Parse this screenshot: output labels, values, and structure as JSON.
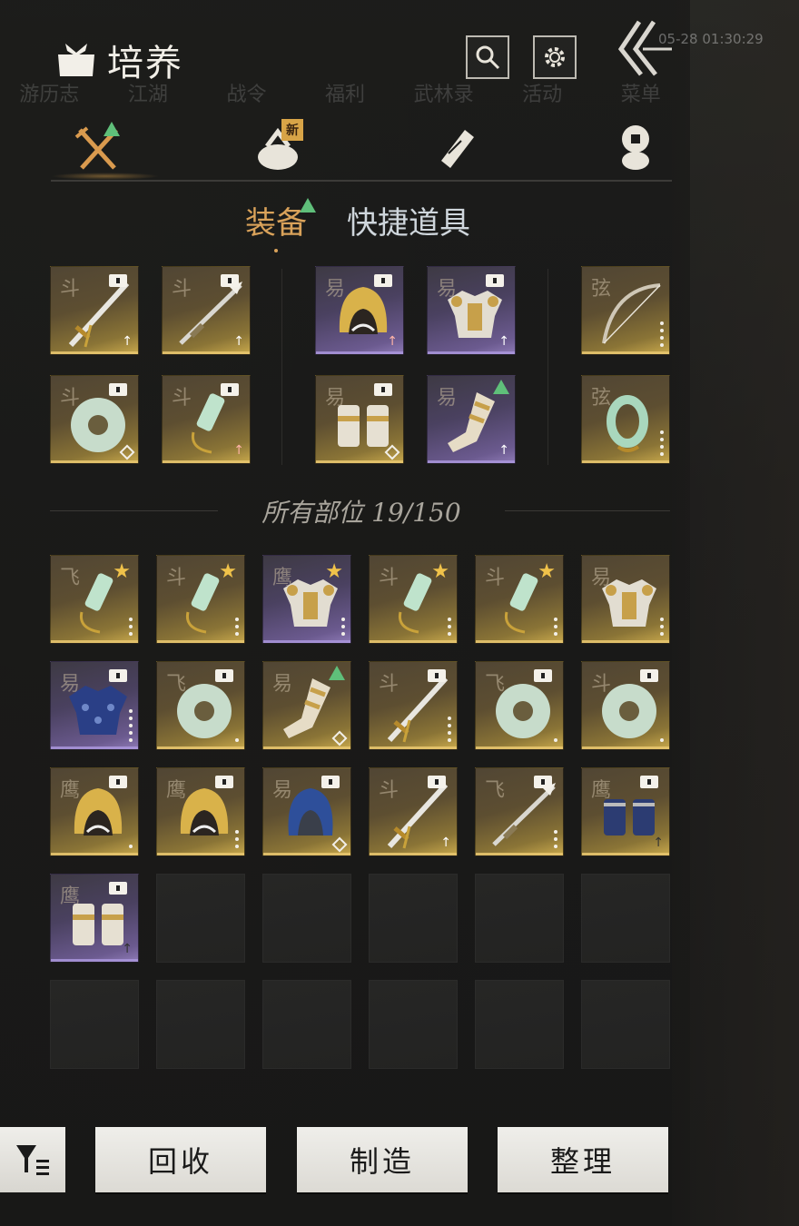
{
  "header": {
    "title": "培养",
    "time_ghost": "05-28 01:30:29"
  },
  "ghost_menu": [
    "游历志",
    "江湖",
    "战令",
    "福利",
    "武林录",
    "活动",
    "菜单"
  ],
  "category_tabs": [
    {
      "name": "equipment-tab",
      "icon": "crossed-swords-icon",
      "has_up_arrow": true
    },
    {
      "name": "bundle-tab",
      "icon": "cloth-bundle-icon",
      "badge": "新"
    },
    {
      "name": "scroll-tab",
      "icon": "scroll-icon"
    },
    {
      "name": "coin-tab",
      "icon": "coin-stack-icon"
    }
  ],
  "sub_tabs": {
    "equipment": "装备",
    "quick_items": "快捷道具"
  },
  "section_label": "所有部位 19/150",
  "equipped": [
    {
      "char": "斗",
      "item": "sword",
      "rarity": "gold",
      "tag": "lock",
      "corner": "arrow"
    },
    {
      "char": "斗",
      "item": "spear",
      "rarity": "gold",
      "tag": "lock",
      "corner": "arrow"
    },
    {
      "char": "易",
      "item": "helmet",
      "rarity": "purple",
      "tag": "lock",
      "corner": "arrow-pink"
    },
    {
      "char": "易",
      "item": "chest",
      "rarity": "purple",
      "tag": "lock",
      "corner": "arrow"
    },
    {
      "char": "弦",
      "item": "bow",
      "rarity": "gold",
      "tag": "",
      "corner": "dots4"
    },
    {
      "char": "斗",
      "item": "jade-disc",
      "rarity": "gold",
      "tag": "lock",
      "corner": "gem"
    },
    {
      "char": "斗",
      "item": "pendant",
      "rarity": "gold",
      "tag": "lock",
      "corner": "arrow-pink"
    },
    {
      "char": "易",
      "item": "bracers",
      "rarity": "gold",
      "tag": "lock",
      "corner": "gem"
    },
    {
      "char": "易",
      "item": "boots",
      "rarity": "purple",
      "tag": "upgrade",
      "corner": "arrow"
    },
    {
      "char": "弦",
      "item": "jade-ring",
      "rarity": "gold",
      "tag": "",
      "corner": "dots4"
    }
  ],
  "inventory": [
    {
      "char": "飞",
      "item": "pendant",
      "rarity": "gold",
      "tag": "star",
      "corner": "dots3"
    },
    {
      "char": "斗",
      "item": "pendant",
      "rarity": "gold",
      "tag": "star",
      "corner": "dots3"
    },
    {
      "char": "鹰",
      "item": "chest",
      "rarity": "purple",
      "tag": "star",
      "corner": "dots3"
    },
    {
      "char": "斗",
      "item": "pendant",
      "rarity": "gold",
      "tag": "star",
      "corner": "dots3"
    },
    {
      "char": "斗",
      "item": "pendant",
      "rarity": "gold",
      "tag": "star",
      "corner": "dots3"
    },
    {
      "char": "易",
      "item": "chest",
      "rarity": "gold",
      "tag": "",
      "corner": "dots3"
    },
    {
      "char": "易",
      "item": "blue-armor",
      "rarity": "purple",
      "tag": "lock",
      "corner": "dots5"
    },
    {
      "char": "飞",
      "item": "jade-disc",
      "rarity": "gold",
      "tag": "lock",
      "corner": "dot1"
    },
    {
      "char": "易",
      "item": "boots",
      "rarity": "gold",
      "tag": "upgrade",
      "corner": "gem"
    },
    {
      "char": "斗",
      "item": "sword",
      "rarity": "gold",
      "tag": "lock",
      "corner": "dots4"
    },
    {
      "char": "飞",
      "item": "jade-disc",
      "rarity": "gold",
      "tag": "lock",
      "corner": "dot1"
    },
    {
      "char": "斗",
      "item": "jade-disc",
      "rarity": "gold",
      "tag": "lock",
      "corner": "dot1"
    },
    {
      "char": "鹰",
      "item": "helmet",
      "rarity": "gold",
      "tag": "lock",
      "corner": "dot1"
    },
    {
      "char": "鹰",
      "item": "helmet",
      "rarity": "gold",
      "tag": "lock",
      "corner": "dots3"
    },
    {
      "char": "易",
      "item": "blue-helmet",
      "rarity": "gold",
      "tag": "lock",
      "corner": "gem"
    },
    {
      "char": "斗",
      "item": "sword",
      "rarity": "gold",
      "tag": "lock",
      "corner": "arrow"
    },
    {
      "char": "飞",
      "item": "spear",
      "rarity": "gold",
      "tag": "lock",
      "corner": "dots3"
    },
    {
      "char": "鹰",
      "item": "blue-bracers",
      "rarity": "gold",
      "tag": "lock",
      "corner": "arrow-dark"
    },
    {
      "char": "鹰",
      "item": "bracers",
      "rarity": "purple",
      "tag": "lock",
      "corner": "arrow-dark"
    }
  ],
  "empty_slot_count": 11,
  "buttons": {
    "recycle": "回收",
    "craft": "制造",
    "sort": "整理"
  },
  "colors": {
    "accent_gold": "#d9a25a",
    "upgrade_green": "#5fbf7a",
    "star_yellow": "#f0c24a",
    "new_badge": "#d8a447"
  }
}
